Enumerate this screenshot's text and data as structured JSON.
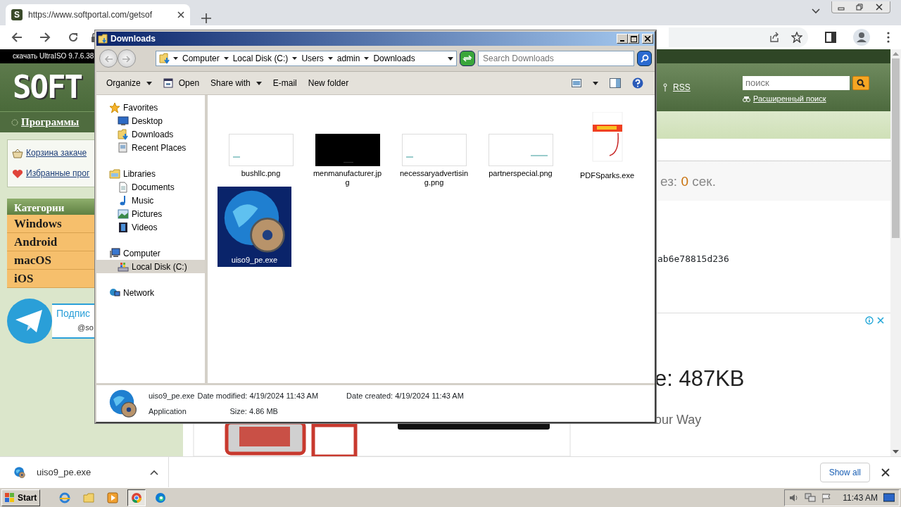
{
  "browser": {
    "tab": {
      "favicon": "S",
      "title": "https://www.softportal.com/getsof"
    }
  },
  "page": {
    "top_strip": "скачать UltraISO 9.7.6.38",
    "logo": "SOFT",
    "rss": "RSS",
    "search": {
      "placeholder": "поиск"
    },
    "advanced_search": "Расширенный поиск",
    "nav": "Программы",
    "links": [
      {
        "text": "Корзина закаче",
        "kind": "basket"
      },
      {
        "text": "Избранные прог",
        "kind": "heart"
      }
    ],
    "categories": {
      "title": "Категории",
      "items": [
        "Windows",
        "Android",
        "macOS",
        "iOS"
      ]
    },
    "telegram": {
      "title": "Подпис",
      "handle": "@so"
    },
    "countdown": {
      "prefix": "ез:",
      "seconds": "0",
      "suffix": "сек."
    },
    "hash": "ab6e78815d236",
    "ad": {
      "size": "e: 487KB",
      "tagline": "our Way"
    }
  },
  "explorer": {
    "title": "Downloads",
    "breadcrumb": [
      "Computer",
      "Local Disk (C:)",
      "Users",
      "admin",
      "Downloads"
    ],
    "search": {
      "placeholder": "Search Downloads"
    },
    "toolbar": [
      {
        "label": "Organize",
        "kind": "menu"
      },
      {
        "label": "Open",
        "kind": "icon"
      },
      {
        "label": "Share with",
        "kind": "menu"
      },
      {
        "label": "E-mail",
        "kind": "plain"
      },
      {
        "label": "New folder",
        "kind": "plain"
      }
    ],
    "tree": [
      {
        "label": "Favorites",
        "kind": "star",
        "selected": false,
        "children": [
          {
            "label": "Desktop",
            "kind": "desktop",
            "selected": false
          },
          {
            "label": "Downloads",
            "kind": "downloads",
            "selected": false
          },
          {
            "label": "Recent Places",
            "kind": "recent",
            "selected": false
          }
        ]
      },
      {
        "label": "Libraries",
        "kind": "libraries",
        "selected": false,
        "children": [
          {
            "label": "Documents",
            "kind": "documents",
            "selected": false
          },
          {
            "label": "Music",
            "kind": "music",
            "selected": false
          },
          {
            "label": "Pictures",
            "kind": "pictures",
            "selected": false
          },
          {
            "label": "Videos",
            "kind": "videos",
            "selected": false
          }
        ]
      },
      {
        "label": "Computer",
        "kind": "computer",
        "selected": false,
        "children": [
          {
            "label": "Local Disk (C:)",
            "kind": "disk",
            "selected": true
          }
        ]
      },
      {
        "label": "Network",
        "kind": "network",
        "selected": false
      }
    ],
    "files": [
      {
        "name": "bushllc.png",
        "kind": "image-light",
        "selected": false
      },
      {
        "name": "menmanufacturer.jpg",
        "kind": "image-dark",
        "selected": false
      },
      {
        "name": "necessaryadvertising.png",
        "kind": "image-light",
        "selected": false
      },
      {
        "name": "partnerspecial.png",
        "kind": "image-light",
        "selected": false
      },
      {
        "name": "PDFSparks.exe",
        "kind": "exe-pdf",
        "selected": false
      },
      {
        "name": "uiso9_pe.exe",
        "kind": "exe-globe",
        "selected": true
      }
    ],
    "details": {
      "name": "uiso9_pe.exe",
      "type": "Application",
      "modified_label": "Date modified:",
      "modified": "4/19/2024 11:43 AM",
      "size_label": "Size:",
      "size": "4.86 MB",
      "created_label": "Date created:",
      "created": "4/19/2024 11:43 AM"
    }
  },
  "downloads_bar": {
    "items": [
      {
        "name": "uiso9_pe.exe"
      }
    ],
    "show_all": "Show all"
  },
  "taskbar": {
    "start": "Start",
    "apps": [
      {
        "kind": "ie",
        "selected": false
      },
      {
        "kind": "folder",
        "selected": false
      },
      {
        "kind": "media",
        "selected": false
      },
      {
        "kind": "chrome",
        "selected": true
      },
      {
        "kind": "edge",
        "selected": false
      }
    ],
    "clock": "11:43 AM"
  }
}
